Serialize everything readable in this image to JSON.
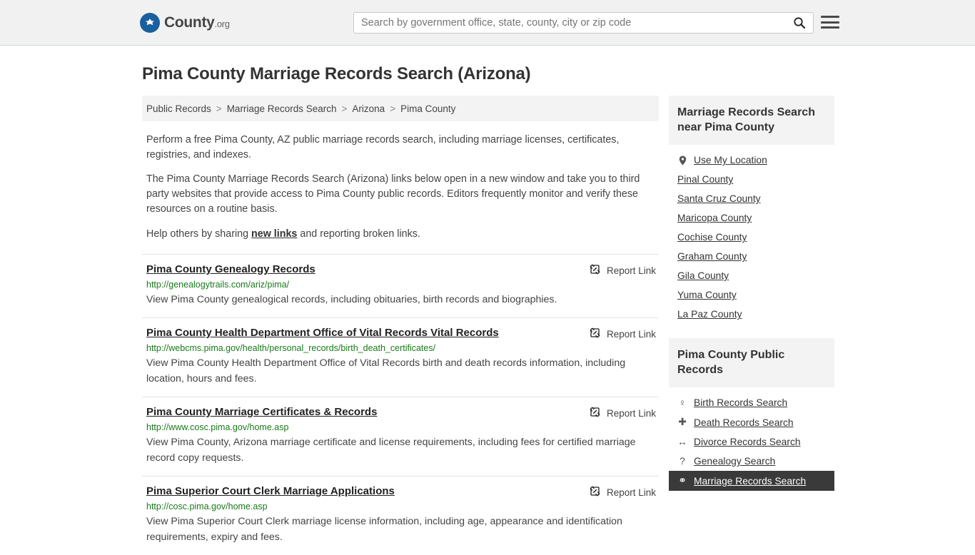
{
  "header": {
    "logo_name": "County",
    "logo_suffix": ".org",
    "logo_icon": "eagle-seal-icon",
    "search_placeholder": "Search by government office, state, county, city or zip code",
    "search_value": "",
    "search_icon": "search-icon",
    "menu_icon": "hamburger-menu-icon"
  },
  "page": {
    "title": "Pima County Marriage Records Search (Arizona)"
  },
  "breadcrumb": {
    "items": [
      {
        "label": "Public Records"
      },
      {
        "label": "Marriage Records Search"
      },
      {
        "label": "Arizona"
      },
      {
        "label": "Pima County"
      }
    ],
    "separator": ">"
  },
  "intro": {
    "p1": "Perform a free Pima County, AZ public marriage records search, including marriage licenses, certificates, registries, and indexes.",
    "p2": "The Pima County Marriage Records Search (Arizona) links below open in a new window and take you to third party websites that provide access to Pima County public records. Editors frequently monitor and verify these resources on a routine basis.",
    "p3_before": "Help others by sharing ",
    "p3_link": "new links",
    "p3_after": " and reporting broken links."
  },
  "results": {
    "report_label": "Report Link",
    "report_icon": "broken-link-icon",
    "items": [
      {
        "title": "Pima County Genealogy Records",
        "url": "http://genealogytrails.com/ariz/pima/",
        "description": "View Pima County genealogical records, including obituaries, birth records and biographies."
      },
      {
        "title": "Pima County Health Department Office of Vital Records Vital Records",
        "url": "http://webcms.pima.gov/health/personal_records/birth_death_certificates/",
        "description": "View Pima County Health Department Office of Vital Records birth and death records information, including location, hours and fees."
      },
      {
        "title": "Pima County Marriage Certificates & Records",
        "url": "http://www.cosc.pima.gov/home.asp",
        "description": "View Pima County, Arizona marriage certificate and license requirements, including fees for certified marriage record copy requests."
      },
      {
        "title": "Pima Superior Court Clerk Marriage Applications",
        "url": "http://cosc.pima.gov/home.asp",
        "description": "View Pima Superior Court Clerk marriage license information, including age, appearance and identification requirements, expiry and fees."
      }
    ]
  },
  "sidebar": {
    "nearby": {
      "heading": "Marriage Records Search near Pima County",
      "items": [
        {
          "label": "Use My Location",
          "icon": "location-pin-icon"
        },
        {
          "label": "Pinal County",
          "icon": ""
        },
        {
          "label": "Santa Cruz County",
          "icon": ""
        },
        {
          "label": "Maricopa County",
          "icon": ""
        },
        {
          "label": "Cochise County",
          "icon": ""
        },
        {
          "label": "Graham County",
          "icon": ""
        },
        {
          "label": "Gila County",
          "icon": ""
        },
        {
          "label": "Yuma County",
          "icon": ""
        },
        {
          "label": "La Paz County",
          "icon": ""
        }
      ]
    },
    "public_records": {
      "heading": "Pima County Public Records",
      "items": [
        {
          "label": "Birth Records Search",
          "icon": "baby-icon",
          "glyph": "♀",
          "active": false
        },
        {
          "label": "Death Records Search",
          "icon": "cross-icon",
          "glyph": "✚",
          "active": false
        },
        {
          "label": "Divorce Records Search",
          "icon": "split-arrow-icon",
          "glyph": "↔",
          "active": false
        },
        {
          "label": "Genealogy Search",
          "icon": "question-mark-icon",
          "glyph": "?",
          "active": false
        },
        {
          "label": "Marriage Records Search",
          "icon": "rings-icon",
          "glyph": "⚭",
          "active": true
        }
      ]
    }
  },
  "colors": {
    "accent_blue": "#1a5f9e",
    "url_green": "#1a7a1a",
    "panel_gray": "#f3f3f3",
    "active_dark": "#3a3a3a"
  }
}
